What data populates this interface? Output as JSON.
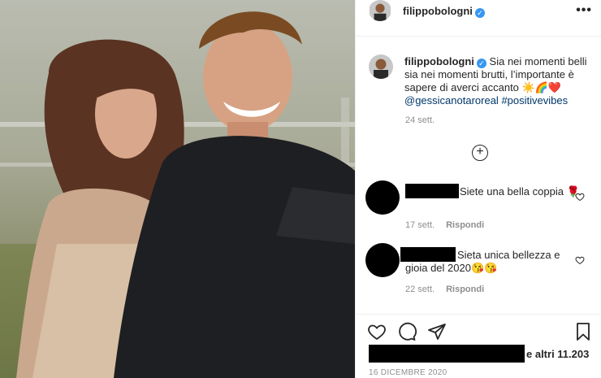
{
  "post": {
    "username": "filippobologni",
    "verified_glyph": "✓",
    "more_glyph": "•••",
    "caption": {
      "text": "Sia nei momenti belli sia nei momenti brutti, l’importante è sapere di averci accanto ☀️🌈❤️",
      "mention": "@gessicanotaroreal",
      "hashtag": "#positivevibes",
      "time": "24 sett."
    },
    "load_more_glyph": "+",
    "comments": [
      {
        "text": "Siete una bella coppia 🌹",
        "time": "17 sett.",
        "reply": "Rispondi"
      },
      {
        "text": "Sieta unica bellezza e gioia del 2020😘😘",
        "time": "22 sett.",
        "reply": "Rispondi"
      }
    ],
    "likes_text": "e altri 11.203",
    "date": "16 DICEMBRE 2020"
  },
  "icons": {
    "header_avatar": "avatar",
    "like": "heart-icon",
    "comment": "comment-icon",
    "share": "share-icon",
    "save": "bookmark-icon",
    "comment_like": "heart-icon",
    "load_more": "plus-circle-icon"
  },
  "colors": {
    "verified": "#3897f0",
    "link": "#00376b",
    "muted": "#8e8e8e",
    "text": "#262626"
  }
}
